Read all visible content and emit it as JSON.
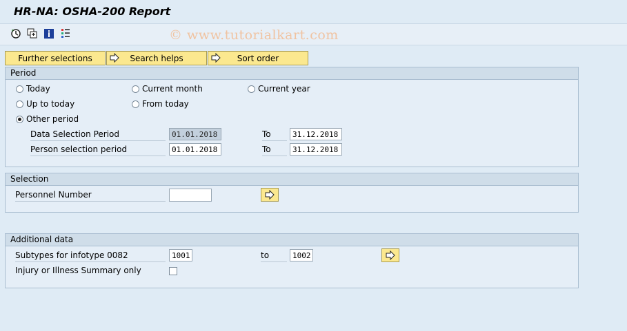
{
  "title": "HR-NA: OSHA-200 Report",
  "watermark": "© www.tutorialkart.com",
  "toolbar_icons": [
    "execute-icon",
    "variant-icon",
    "info-icon",
    "layout-icon"
  ],
  "buttons": {
    "further_selections": "Further selections",
    "search_helps": "Search helps",
    "sort_order": "Sort order"
  },
  "period": {
    "header": "Period",
    "options": {
      "today": "Today",
      "current_month": "Current month",
      "current_year": "Current year",
      "up_to_today": "Up to today",
      "from_today": "From today",
      "other_period": "Other period"
    },
    "selected": "other_period",
    "data_selection_label": "Data Selection Period",
    "data_from": "01.01.2018",
    "data_to_label": "To",
    "data_to": "31.12.2018",
    "person_selection_label": "Person selection period",
    "person_from": "01.01.2018",
    "person_to_label": "To",
    "person_to": "31.12.2018"
  },
  "selection": {
    "header": "Selection",
    "personnel_label": "Personnel Number",
    "personnel_value": ""
  },
  "additional": {
    "header": "Additional data",
    "subtypes_label": "Subtypes for infotype 0082",
    "subtypes_from": "1001",
    "to_label": "to",
    "subtypes_to": "1002",
    "summary_label": "Injury or Illness Summary only",
    "summary_checked": false
  },
  "colors": {
    "background": "#dfebf5",
    "button_yellow": "#fbe88f",
    "panel_header": "#cfdde9"
  }
}
